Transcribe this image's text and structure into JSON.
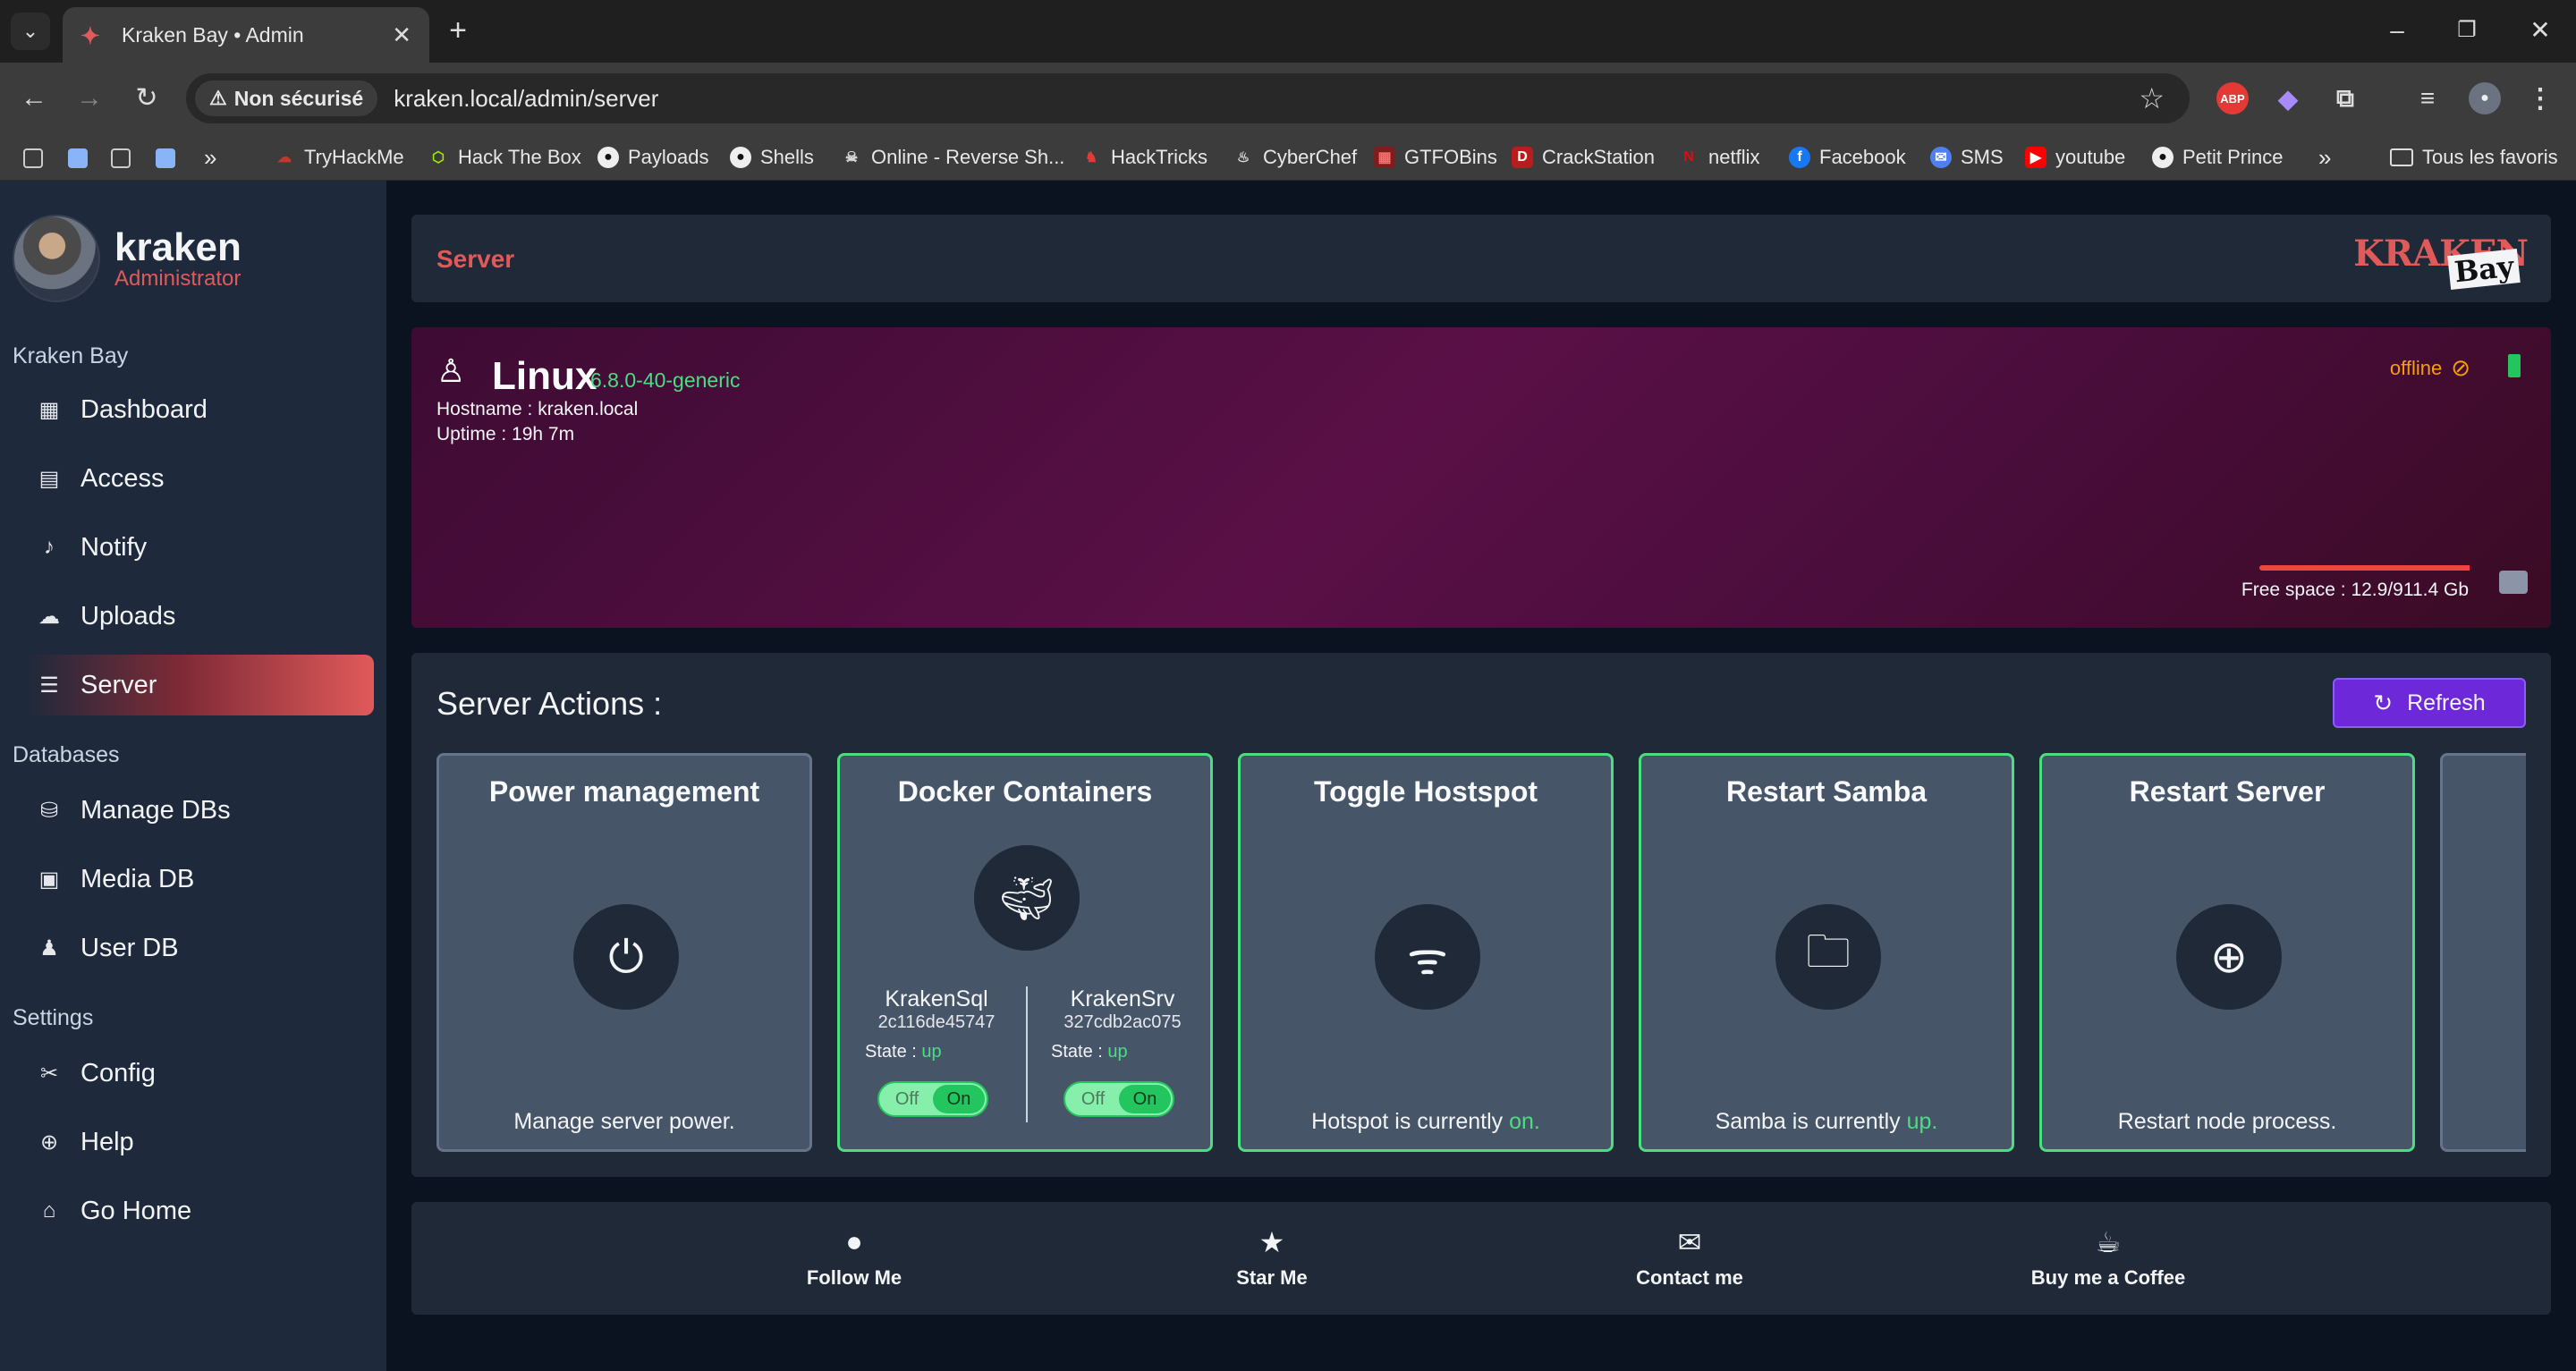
{
  "browser": {
    "tab_title": "Kraken Bay • Admin",
    "security_label": "Non sécurisé",
    "url": "kraken.local/admin/server",
    "bookmarks": [
      "TryHackMe",
      "Hack The Box",
      "Payloads",
      "Shells",
      "Online - Reverse Sh...",
      "HackTricks",
      "CyberChef",
      "GTFOBins",
      "CrackStation",
      "netflix",
      "Facebook",
      "SMS",
      "youtube",
      "Petit Prince"
    ],
    "all_bookmarks": "Tous les favoris",
    "extensions": [
      "ABP"
    ]
  },
  "sidebar": {
    "user_name": "kraken",
    "user_role": "Administrator",
    "sections": [
      {
        "title": "Kraken Bay",
        "items": [
          "Dashboard",
          "Access",
          "Notify",
          "Uploads",
          "Server"
        ]
      },
      {
        "title": "Databases",
        "items": [
          "Manage DBs",
          "Media DB",
          "User DB"
        ]
      },
      {
        "title": "Settings",
        "items": [
          "Config",
          "Help",
          "Go Home"
        ]
      }
    ],
    "active_item": "Server"
  },
  "header": {
    "title": "Server",
    "logo_top": "KRAKEN",
    "logo_bottom": "Bay"
  },
  "system": {
    "os": "Linux",
    "kernel": "6.8.0-40-generic",
    "hostname": "Hostname : kraken.local",
    "uptime": "Uptime : 19h 7m",
    "network_status": "offline",
    "free_space": "Free space : 12.9/911.4 Gb",
    "disk_used_fraction": 0.986
  },
  "actions": {
    "title": "Server Actions :",
    "refresh_label": "Refresh",
    "cards": [
      {
        "title": "Power management",
        "text": "Manage server power."
      },
      {
        "title": "Docker Containers"
      },
      {
        "title": "Toggle Hostspot",
        "text_prefix": "Hotspot is currently ",
        "text_state": "on."
      },
      {
        "title": "Restart Samba",
        "text_prefix": "Samba is currently ",
        "text_state": "up."
      },
      {
        "title": "Restart Server",
        "text": "Restart node process."
      }
    ],
    "containers": [
      {
        "name": "KrakenSql",
        "id": "2c116de45747",
        "state_label": "State : ",
        "state": "up",
        "toggle_off": "Off",
        "toggle_on": "On"
      },
      {
        "name": "KrakenSrv",
        "id": "327cdb2ac075",
        "state_label": "State : ",
        "state": "up",
        "toggle_off": "Off",
        "toggle_on": "On"
      }
    ]
  },
  "footer": {
    "items": [
      "Follow Me",
      "Star Me",
      "Contact me",
      "Buy me a Coffee"
    ]
  },
  "colors": {
    "accent": "#e05a5a",
    "success": "#4ade80",
    "refresh": "#6d28d9",
    "system_card": "#5a1046"
  }
}
